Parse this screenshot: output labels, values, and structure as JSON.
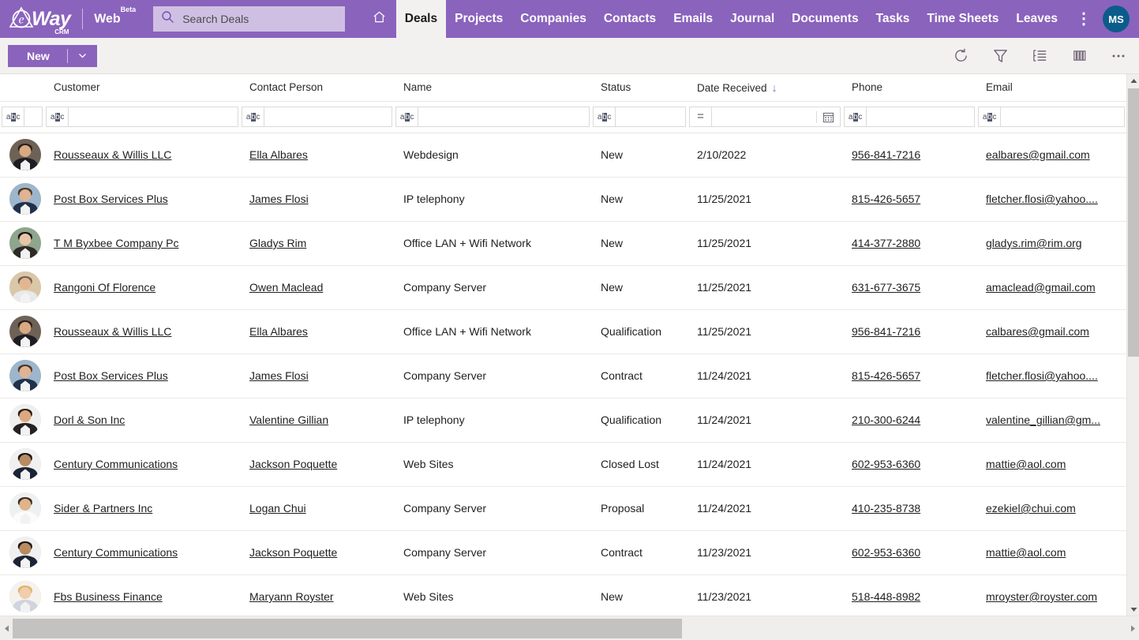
{
  "brand": {
    "logo_text": "Way",
    "logo_sub": "CRM",
    "logo_letter": "e",
    "product": "Web",
    "product_sup": "Beta",
    "primary_color": "#8a63bd",
    "topbar_color": "#8a63bd",
    "search_box_color": "#cfc0e3",
    "avatar_color": "#0b5c8a",
    "active_tab_bg": "#f2f1f0"
  },
  "search": {
    "placeholder": "Search Deals",
    "value": "",
    "icon": "search-icon"
  },
  "nav": {
    "home_icon": "home-icon",
    "items": [
      {
        "label": "Deals",
        "active": true
      },
      {
        "label": "Projects",
        "active": false
      },
      {
        "label": "Companies",
        "active": false
      },
      {
        "label": "Contacts",
        "active": false
      },
      {
        "label": "Emails",
        "active": false
      },
      {
        "label": "Journal",
        "active": false
      },
      {
        "label": "Documents",
        "active": false
      },
      {
        "label": "Tasks",
        "active": false
      },
      {
        "label": "Time Sheets",
        "active": false
      },
      {
        "label": "Leaves",
        "active": false
      }
    ],
    "kebab_icon": "more-vertical-icon",
    "user_initials": "MS"
  },
  "toolbar": {
    "new_label": "New",
    "new_caret_icon": "chevron-down-icon",
    "icons": [
      {
        "name": "refresh-icon"
      },
      {
        "name": "filter-icon"
      },
      {
        "name": "group-list-icon"
      },
      {
        "name": "columns-icon"
      },
      {
        "name": "more-horizontal-icon"
      }
    ]
  },
  "grid": {
    "columns": [
      {
        "key": "avatar",
        "label": "",
        "filter": "abc",
        "sorted": ""
      },
      {
        "key": "customer",
        "label": "Customer",
        "filter": "abc",
        "sorted": ""
      },
      {
        "key": "contact",
        "label": "Contact Person",
        "filter": "abc",
        "sorted": ""
      },
      {
        "key": "name",
        "label": "Name",
        "filter": "abc",
        "sorted": ""
      },
      {
        "key": "status",
        "label": "Status",
        "filter": "abc",
        "sorted": ""
      },
      {
        "key": "date",
        "label": "Date Received",
        "filter": "eq",
        "sorted": "desc"
      },
      {
        "key": "phone",
        "label": "Phone",
        "filter": "abc",
        "sorted": ""
      },
      {
        "key": "email",
        "label": "Email",
        "filter": "abc",
        "sorted": ""
      }
    ],
    "sort_arrow_glyph": "↓",
    "filter_values": {
      "avatar": "",
      "customer": "",
      "contact": "",
      "name": "",
      "status": "",
      "date": "",
      "phone": "",
      "email": ""
    },
    "rows": [
      {
        "customer": "Rousseaux & Willis LLC",
        "contact": "Ella Albares",
        "name": "Webdesign",
        "status": "New",
        "date": "2/10/2022",
        "phone": "956-841-7216",
        "email": "ealbares@gmail.com",
        "avatar": {
          "bg": "#6e6257",
          "skin": "#d8a982",
          "hair": "#2a1f19",
          "body": "#1d1d24"
        }
      },
      {
        "customer": "Post Box Services Plus",
        "contact": "James Flosi",
        "name": "IP telephony",
        "status": "New",
        "date": "11/25/2021",
        "phone": "815-426-5657",
        "email": "fletcher.flosi@yahoo....",
        "avatar": {
          "bg": "#9db6cc",
          "skin": "#e0b394",
          "hair": "#4e3422",
          "body": "#22314a"
        }
      },
      {
        "customer": "T M Byxbee Company Pc",
        "contact": "Gladys Rim",
        "name": "Office LAN + Wifi Network",
        "status": "New",
        "date": "11/25/2021",
        "phone": "414-377-2880",
        "email": "gladys.rim@rim.org",
        "avatar": {
          "bg": "#8fa58d",
          "skin": "#e8c5a6",
          "hair": "#17120f",
          "body": "#2e2a28"
        }
      },
      {
        "customer": "Rangoni Of Florence",
        "contact": "Owen Maclead",
        "name": "Company Server",
        "status": "New",
        "date": "11/25/2021",
        "phone": "631-677-3675",
        "email": "amaclead@gmail.com",
        "avatar": {
          "bg": "#d9c7a8",
          "skin": "#e3b591",
          "hair": "#6d6258",
          "body": "#e9e9ec"
        }
      },
      {
        "customer": "Rousseaux & Willis LLC",
        "contact": "Ella Albares",
        "name": "Office LAN + Wifi Network",
        "status": "Qualification",
        "date": "11/25/2021",
        "phone": "956-841-7216",
        "email": "calbares@gmail.com",
        "avatar": {
          "bg": "#6e6257",
          "skin": "#d8a982",
          "hair": "#2a1f19",
          "body": "#1d1d24"
        }
      },
      {
        "customer": "Post Box Services Plus",
        "contact": "James Flosi",
        "name": "Company Server",
        "status": "Contract",
        "date": "11/24/2021",
        "phone": "815-426-5657",
        "email": "fletcher.flosi@yahoo....",
        "avatar": {
          "bg": "#9db6cc",
          "skin": "#e0b394",
          "hair": "#4e3422",
          "body": "#22314a"
        }
      },
      {
        "customer": "Dorl & Son Inc",
        "contact": "Valentine Gillian",
        "name": "IP telephony",
        "status": "Qualification",
        "date": "11/24/2021",
        "phone": "210-300-6244",
        "email": "valentine_gillian@gm...",
        "avatar": {
          "bg": "#efefef",
          "skin": "#dda87f",
          "hair": "#241a12",
          "body": "#262021"
        }
      },
      {
        "customer": "Century Communications",
        "contact": "Jackson Poquette",
        "name": "Web Sites",
        "status": "Closed Lost",
        "date": "11/24/2021",
        "phone": "602-953-6360",
        "email": "mattie@aol.com",
        "avatar": {
          "bg": "#f0f0f0",
          "skin": "#b98b62",
          "hair": "#191410",
          "body": "#1b2436"
        }
      },
      {
        "customer": "Sider & Partners Inc",
        "contact": "Logan Chui",
        "name": "Company Server",
        "status": "Proposal",
        "date": "11/24/2021",
        "phone": "410-235-8738",
        "email": "ezekiel@chui.com",
        "avatar": {
          "bg": "#eef1f2",
          "skin": "#dfb38c",
          "hair": "#3a2a1d",
          "body": "#fbfbfb"
        }
      },
      {
        "customer": "Century Communications",
        "contact": "Jackson Poquette",
        "name": "Company Server",
        "status": "Contract",
        "date": "11/23/2021",
        "phone": "602-953-6360",
        "email": "mattie@aol.com",
        "avatar": {
          "bg": "#f0f0f0",
          "skin": "#b98b62",
          "hair": "#191410",
          "body": "#1b2436"
        }
      },
      {
        "customer": "Fbs Business Finance",
        "contact": "Maryann Royster",
        "name": "Web Sites",
        "status": "New",
        "date": "11/23/2021",
        "phone": "518-448-8982",
        "email": "mroyster@royster.com",
        "avatar": {
          "bg": "#f5f2ee",
          "skin": "#f0cdad",
          "hair": "#ddb46a",
          "body": "#cfd4de"
        }
      }
    ]
  },
  "scrollbars": {
    "vertical": {
      "up_icon": "caret-up-icon",
      "down_icon": "caret-down-icon"
    },
    "horizontal": {
      "left_icon": "caret-left-icon",
      "right_icon": "caret-right-icon"
    }
  }
}
